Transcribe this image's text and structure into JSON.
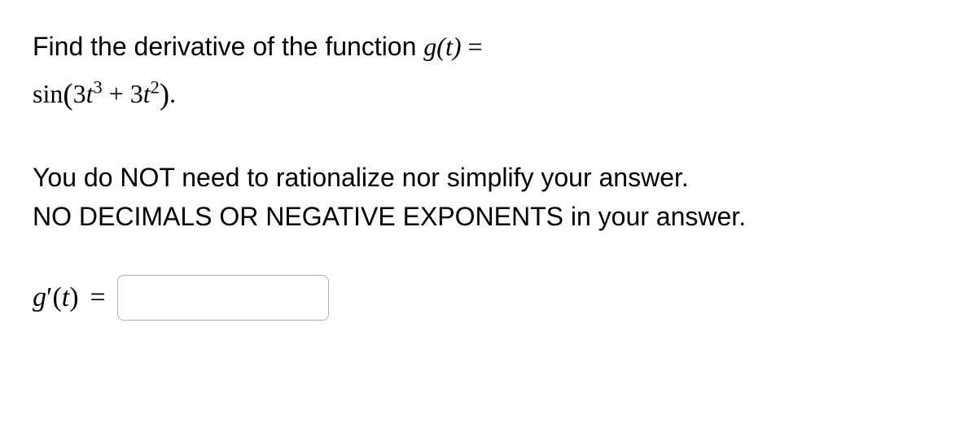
{
  "question": {
    "prompt_prefix": "Find the derivative of the function ",
    "function_lhs": "g(t)",
    "equals": " = ",
    "function_rhs_sin": "sin",
    "function_rhs_open": "(",
    "function_rhs_term1_coeff": "3",
    "function_rhs_term1_var": "t",
    "function_rhs_term1_exp": "3",
    "function_rhs_plus": " + ",
    "function_rhs_term2_coeff": "3",
    "function_rhs_term2_var": "t",
    "function_rhs_term2_exp": "2",
    "function_rhs_close": ")",
    "period": "."
  },
  "instructions": {
    "line1": "You do NOT need to rationalize nor simplify your answer.",
    "line2": "NO DECIMALS OR NEGATIVE EXPONENTS in your answer."
  },
  "answer": {
    "label_g": "g",
    "label_prime": "′",
    "label_paren_open": "(",
    "label_var": "t",
    "label_paren_close": ")",
    "equals": "=",
    "input_value": ""
  }
}
